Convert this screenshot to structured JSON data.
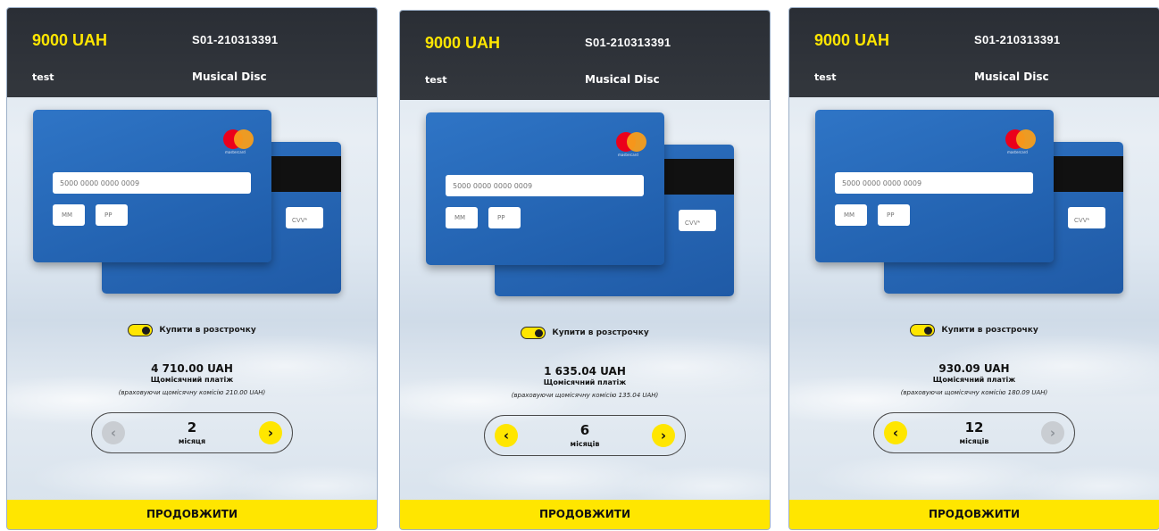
{
  "panels": [
    {
      "amount": "9000 UAH",
      "order_id": "S01-210313391",
      "name": "test",
      "product": "Musical Disc",
      "card_number_placeholder": "5000 0000 0000 0009",
      "mm_placeholder": "MM",
      "yy_placeholder": "РР",
      "cvv_placeholder": "CVV*",
      "mastercard_text": "mastercard",
      "installment_label": "Купити в розстрочку",
      "monthly_amount": "4 710.00 UAH",
      "monthly_label": "Щомісячний платіж",
      "commission_note": "(враховуючи щомісячну комісію 210.00 UAH)",
      "months": "2",
      "months_unit": "місяця",
      "prev_glyph": "‹",
      "next_glyph": "›",
      "prev_enabled": false,
      "next_enabled": true,
      "continue_label": "ПРОДОВЖИТИ"
    },
    {
      "amount": "9000 UAH",
      "order_id": "S01-210313391",
      "name": "test",
      "product": "Musical Disc",
      "card_number_placeholder": "5000 0000 0000 0009",
      "mm_placeholder": "MM",
      "yy_placeholder": "РР",
      "cvv_placeholder": "CVV*",
      "mastercard_text": "mastercard",
      "installment_label": "Купити в розстрочку",
      "monthly_amount": "1 635.04 UAH",
      "monthly_label": "Щомісячний платіж",
      "commission_note": "(враховуючи щомісячну комісію 135.04 UAH)",
      "months": "6",
      "months_unit": "місяців",
      "prev_glyph": "‹",
      "next_glyph": "›",
      "prev_enabled": true,
      "next_enabled": true,
      "continue_label": "ПРОДОВЖИТИ"
    },
    {
      "amount": "9000 UAH",
      "order_id": "S01-210313391",
      "name": "test",
      "product": "Musical Disc",
      "card_number_placeholder": "5000 0000 0000 0009",
      "mm_placeholder": "MM",
      "yy_placeholder": "РР",
      "cvv_placeholder": "CVV*",
      "mastercard_text": "mastercard",
      "installment_label": "Купити в розстрочку",
      "monthly_amount": "930.09 UAH",
      "monthly_label": "Щомісячний платіж",
      "commission_note": "(враховуючи щомісячну комісію 180.09 UAH)",
      "months": "12",
      "months_unit": "місяців",
      "prev_glyph": "‹",
      "next_glyph": "›",
      "prev_enabled": true,
      "next_enabled": false,
      "continue_label": "ПРОДОВЖИТИ"
    }
  ],
  "colors": {
    "accent": "#ffe600",
    "header": "#2e3238",
    "card": "#2565b5"
  },
  "icons": {
    "prev": "chevron-left-icon",
    "next": "chevron-right-icon",
    "brand": "mastercard-logo-icon"
  }
}
